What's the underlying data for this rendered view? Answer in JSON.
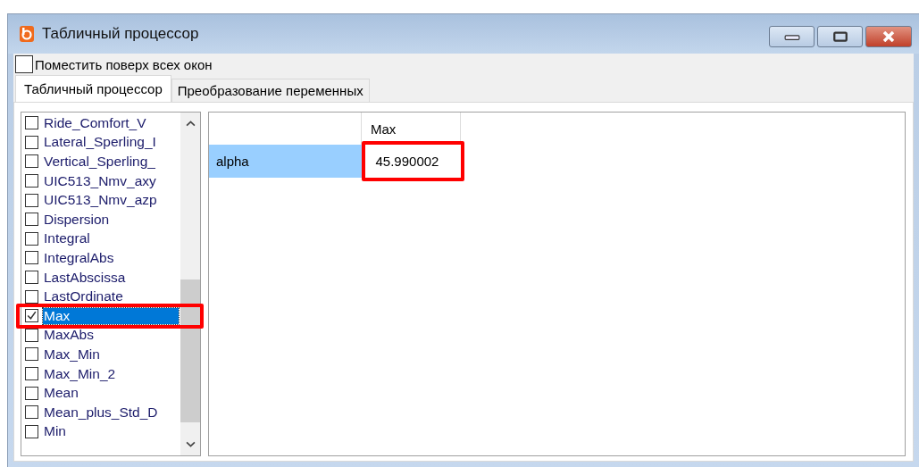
{
  "window": {
    "title": "Табличный процессор"
  },
  "always_on_top": {
    "label": "Поместить поверх всех окон",
    "checked": false
  },
  "tabs": [
    {
      "label": "Табличный процессор",
      "selected": true
    },
    {
      "label": "Преобразование переменных",
      "selected": false
    }
  ],
  "functions": [
    {
      "label": "Ride_Comfort_V",
      "checked": false,
      "selected": false
    },
    {
      "label": "Lateral_Sperling_I",
      "checked": false,
      "selected": false
    },
    {
      "label": "Vertical_Sperling_",
      "checked": false,
      "selected": false
    },
    {
      "label": "UIC513_Nmv_axy",
      "checked": false,
      "selected": false
    },
    {
      "label": "UIC513_Nmv_azp",
      "checked": false,
      "selected": false
    },
    {
      "label": "Dispersion",
      "checked": false,
      "selected": false
    },
    {
      "label": "Integral",
      "checked": false,
      "selected": false
    },
    {
      "label": "IntegralAbs",
      "checked": false,
      "selected": false
    },
    {
      "label": "LastAbscissa",
      "checked": false,
      "selected": false
    },
    {
      "label": "LastOrdinate",
      "checked": false,
      "selected": false
    },
    {
      "label": "Max",
      "checked": true,
      "selected": true
    },
    {
      "label": "MaxAbs",
      "checked": false,
      "selected": false
    },
    {
      "label": "Max_Min",
      "checked": false,
      "selected": false
    },
    {
      "label": "Max_Min_2",
      "checked": false,
      "selected": false
    },
    {
      "label": "Mean",
      "checked": false,
      "selected": false
    },
    {
      "label": "Mean_plus_Std_D",
      "checked": false,
      "selected": false
    },
    {
      "label": "Min",
      "checked": false,
      "selected": false
    }
  ],
  "table": {
    "columns": [
      "Max"
    ],
    "rows": [
      {
        "name": "alpha",
        "values": [
          "45.990002"
        ]
      }
    ]
  }
}
